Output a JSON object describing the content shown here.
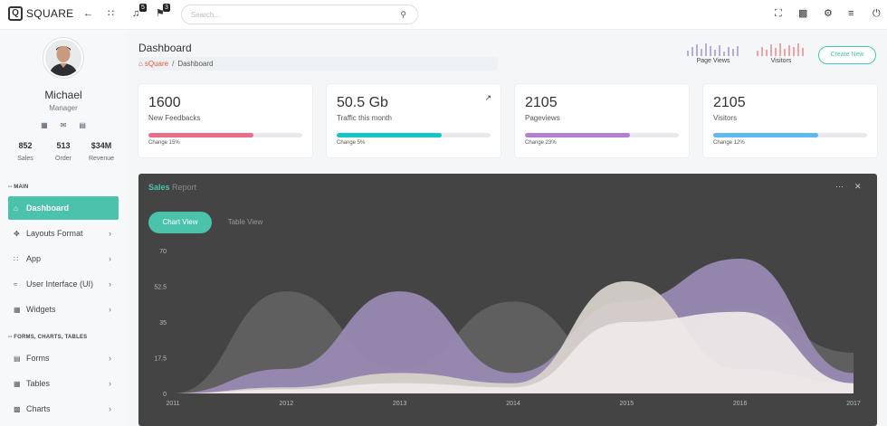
{
  "brand": {
    "logo_letter": "Q",
    "name": "SQUARE"
  },
  "topbar": {
    "notifications_badge": "5",
    "flags_badge": "3",
    "search_placeholder": "Search..."
  },
  "user": {
    "name": "Michael",
    "role": "Manager",
    "stats": [
      {
        "value": "852",
        "label": "Sales"
      },
      {
        "value": "513",
        "label": "Order"
      },
      {
        "value": "$34M",
        "label": "Revenue"
      }
    ]
  },
  "sidebar": {
    "section_main": "-- MAIN",
    "section_forms": "-- FORMS, CHARTS, TABLES",
    "items": [
      {
        "label": "Dashboard",
        "icon": "home-icon"
      },
      {
        "label": "Layouts Format",
        "icon": "move-icon"
      },
      {
        "label": "App",
        "icon": "grid-icon"
      },
      {
        "label": "User Interface (UI)",
        "icon": "brush-icon"
      },
      {
        "label": "Widgets",
        "icon": "widgets-icon"
      },
      {
        "label": "Forms",
        "icon": "form-icon"
      },
      {
        "label": "Tables",
        "icon": "table-icon"
      },
      {
        "label": "Charts",
        "icon": "chart-icon"
      }
    ]
  },
  "header": {
    "title": "Dashboard",
    "breadcrumb_home": "sQuare",
    "breadcrumb_sep": "/",
    "breadcrumb_current": "Dashboard",
    "page_views_label": "Page Views",
    "visitors_label": "Visitors",
    "create_button": "Create New"
  },
  "cards": [
    {
      "value": "1600",
      "label": "New Feedbacks",
      "change": "Change 15%",
      "progress": 0.68,
      "color": "#e86d8a"
    },
    {
      "value": "50.5 Gb",
      "label": "Traffic this month",
      "change": "Change 5%",
      "progress": 0.68,
      "color": "#14c6c6"
    },
    {
      "value": "2105",
      "label": "Pageviews",
      "change": "Change 23%",
      "progress": 0.68,
      "color": "#b37fd4"
    },
    {
      "value": "2105",
      "label": "Visitors",
      "change": "Change 12%",
      "progress": 0.68,
      "color": "#5db8f0"
    }
  ],
  "panel": {
    "title_accent": "Sales",
    "title_rest": " Report",
    "tab_chart": "Chart View",
    "tab_table": "Table View"
  },
  "colors": {
    "accent": "#4bc2ab",
    "panel_bg": "#444444",
    "breadcrumb_home": "#e4573d"
  },
  "chart_data": {
    "type": "area",
    "x": [
      "2011",
      "2012",
      "2013",
      "2014",
      "2015",
      "2016",
      "2017"
    ],
    "yticks": [
      "0",
      "17.5",
      "35",
      "52.5",
      "70"
    ],
    "ylim": [
      0,
      70
    ],
    "series": [
      {
        "values": [
          0,
          50,
          12,
          45,
          8,
          42,
          20
        ],
        "color": "#5f5f5f"
      },
      {
        "values": [
          0,
          12,
          50,
          10,
          45,
          66,
          10
        ],
        "color": "#9a8ab5"
      },
      {
        "values": [
          0,
          3,
          10,
          5,
          55,
          12,
          5
        ],
        "color": "#d8d2cc"
      },
      {
        "values": [
          0,
          2,
          5,
          3,
          35,
          40,
          5
        ],
        "color": "#efeaea"
      }
    ]
  }
}
